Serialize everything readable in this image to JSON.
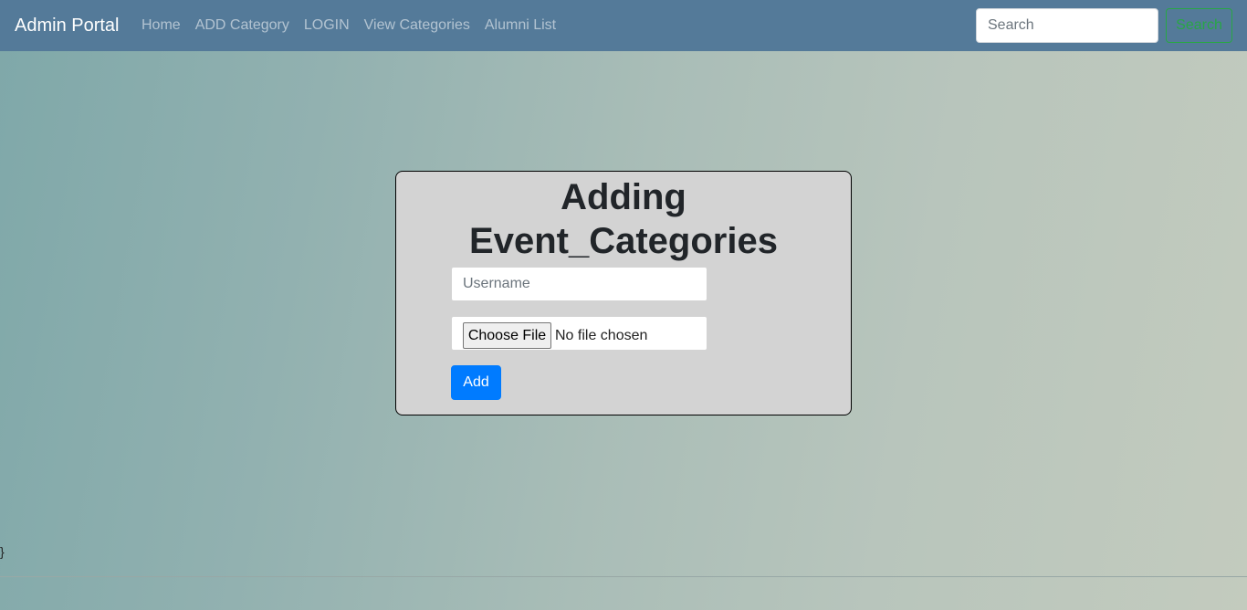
{
  "navbar": {
    "brand": "Admin Portal",
    "links": [
      "Home",
      "ADD Category",
      "LOGIN",
      "View Categories",
      "Alumni List"
    ],
    "search": {
      "placeholder": "Search",
      "value": "",
      "button_label": "Search"
    }
  },
  "form": {
    "title_line1": "Adding",
    "title_line2": "Event_Categories",
    "username_placeholder": "Username",
    "username_value": "",
    "file_button_label": "Choose File",
    "file_status": "No file chosen",
    "submit_label": "Add"
  },
  "stray_text": "}",
  "colors": {
    "navbar_bg": "#547a99",
    "card_bg": "#d3d3d3",
    "primary": "#007bff",
    "success": "#28a745"
  }
}
